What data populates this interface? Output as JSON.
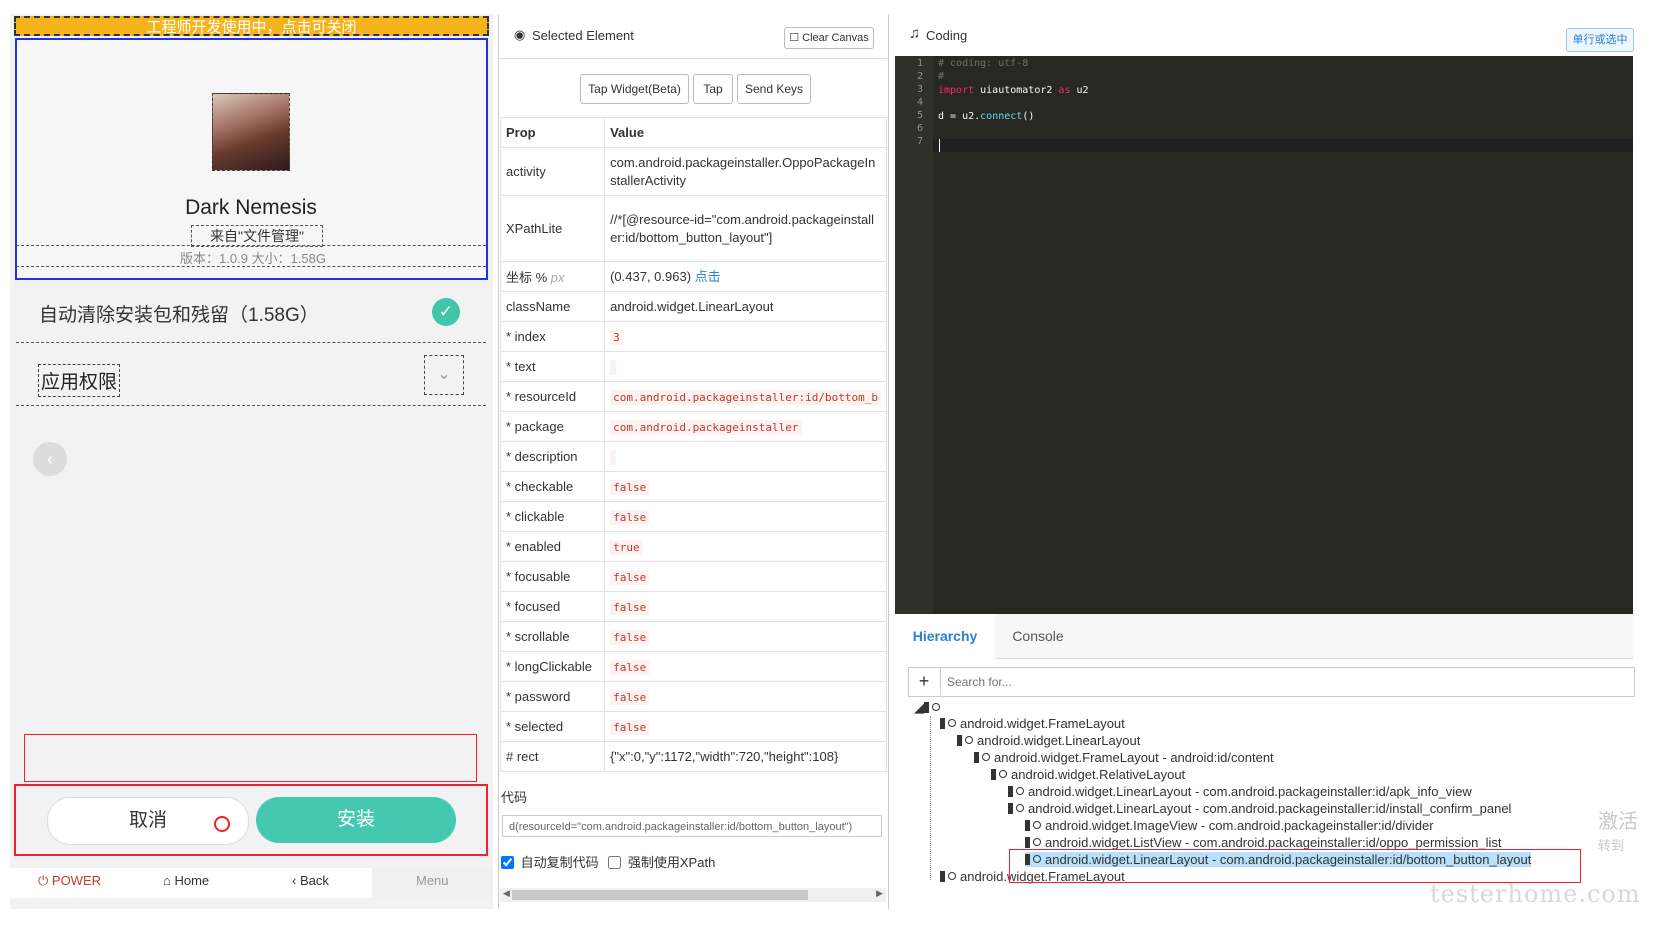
{
  "phone": {
    "dev_banner": "工程师开发使用中，点击可关闭",
    "app_name": "Dark Nemesis",
    "app_source": "来自\"文件管理\"",
    "app_meta": "版本：1.0.9   大小：1.58G",
    "auto_clean_label": "自动清除安装包和残留（1.58G）",
    "permission_label": "应用权限",
    "cancel_button": "取消",
    "install_button": "安装",
    "nav": {
      "power": "⏻ POWER",
      "home": "⌂ Home",
      "back": "‹ Back",
      "menu": "Menu"
    }
  },
  "selected_panel": {
    "title": "Selected Element",
    "clear_canvas": "Clear Canvas",
    "buttons": [
      "Tap Widget(Beta)",
      "Tap",
      "Send Keys"
    ],
    "col_prop": "Prop",
    "col_value": "Value",
    "rows": [
      {
        "prop": "activity",
        "value": "com.android.packageinstaller.OppoPackageInstallerActivity",
        "code": false
      },
      {
        "prop": "XPathLite",
        "value": "//*[@resource-id=\"com.android.packageinstaller:id/bottom_button_layout\"]",
        "code": false
      },
      {
        "prop": "坐标 % px",
        "value": "(0.437, 0.963) 点击",
        "code": false
      },
      {
        "prop": "className",
        "value": "android.widget.LinearLayout",
        "code": false
      },
      {
        "prop": "* index",
        "value": "3",
        "code": true
      },
      {
        "prop": "* text",
        "value": "",
        "code": true
      },
      {
        "prop": "* resourceId",
        "value": "com.android.packageinstaller:id/bottom_b",
        "code": true
      },
      {
        "prop": "* package",
        "value": "com.android.packageinstaller",
        "code": true
      },
      {
        "prop": "* description",
        "value": "",
        "code": true
      },
      {
        "prop": "* checkable",
        "value": "false",
        "code": true
      },
      {
        "prop": "* clickable",
        "value": "false",
        "code": true
      },
      {
        "prop": "* enabled",
        "value": "true",
        "code": true
      },
      {
        "prop": "* focusable",
        "value": "false",
        "code": true
      },
      {
        "prop": "* focused",
        "value": "false",
        "code": true
      },
      {
        "prop": "* scrollable",
        "value": "false",
        "code": true
      },
      {
        "prop": "* longClickable",
        "value": "false",
        "code": true
      },
      {
        "prop": "* password",
        "value": "false",
        "code": true
      },
      {
        "prop": "* selected",
        "value": "false",
        "code": true
      },
      {
        "prop": "# rect",
        "value": "{\"x\":0,\"y\":1172,\"width\":720,\"height\":108}",
        "code": false
      }
    ],
    "code_label": "代码",
    "code_value": "d(resourceId=\"com.android.packageinstaller:id/bottom_button_layout\")",
    "auto_copy": "自动复制代码",
    "force_xpath": "强制使用XPath"
  },
  "coding_panel": {
    "title": "Coding",
    "run_button": "单行或选中",
    "lines": [
      "1",
      "2",
      "3",
      "4",
      "5",
      "6",
      "7"
    ],
    "code": {
      "l1": "# coding: utf-8",
      "l2": "#",
      "l3_kw": "import",
      "l3_rest": " uiautomator2 ",
      "l3_as": "as",
      "l3_alias": " u2",
      "l5_a": "d = u2.",
      "l5_fn": "connect",
      "l5_b": "()"
    }
  },
  "hierarchy": {
    "tab_hierarchy": "Hierarchy",
    "tab_console": "Console",
    "search_placeholder": "Search for...",
    "nodes": [
      "android.widget.FrameLayout",
      "android.widget.LinearLayout",
      "android.widget.FrameLayout - android:id/content",
      "android.widget.RelativeLayout",
      "android.widget.LinearLayout - com.android.packageinstaller:id/apk_info_view",
      "android.widget.LinearLayout - com.android.packageinstaller:id/install_confirm_panel",
      "android.widget.ImageView - com.android.packageinstaller:id/divider",
      "android.widget.ListView - com.android.packageinstaller:id/oppo_permission_list",
      "android.widget.LinearLayout - com.android.packageinstaller:id/bottom_button_layout",
      "android.widget.FrameLayout"
    ]
  },
  "overlay": {
    "watermark": "testerhome.com",
    "activate_1": "激活",
    "activate_2": "转到"
  },
  "colors": {
    "accent_teal": "#44c8b0",
    "banner_orange": "#f6b41c",
    "selection_blue": "#2233dd",
    "highlight_red": "#e23333",
    "link_blue": "#2a7fd3"
  }
}
